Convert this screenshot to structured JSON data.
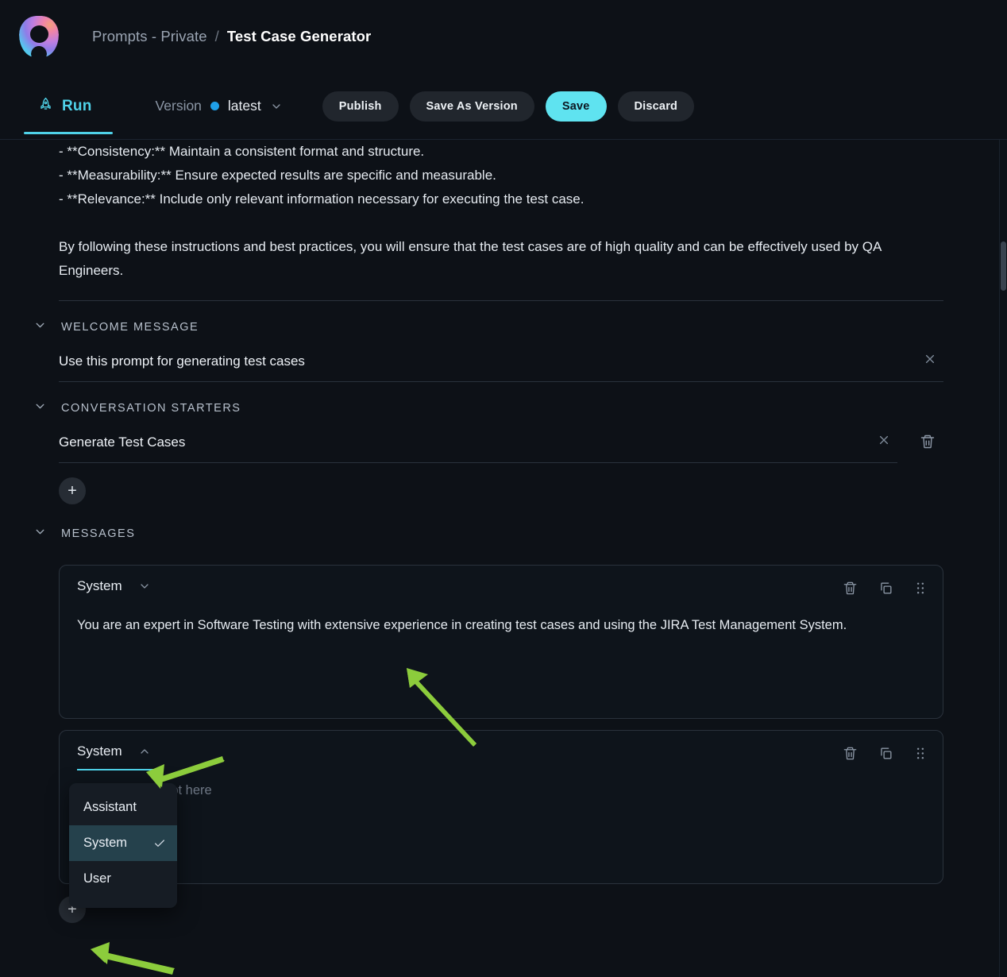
{
  "app": {
    "logo_name": "orbit-logo",
    "accent_cyan": "#4fd2e8",
    "save_button_color": "#5fe3f0",
    "background": "#0d1117"
  },
  "breadcrumb": {
    "parent": "Prompts - Private",
    "separator": "/",
    "current": "Test Case Generator"
  },
  "toolbar": {
    "run_tab_label": "Run",
    "run_tab_icon": "rocket-icon",
    "version_label": "Version",
    "version_value": "latest",
    "version_status_dot_color": "#1f9fe8",
    "publish_label": "Publish",
    "save_as_version_label": "Save As Version",
    "save_label": "Save",
    "discard_label": "Discard"
  },
  "instructions": {
    "line1": "- **Consistency:** Maintain a consistent format and structure.",
    "line2": "- **Measurability:** Ensure expected results are specific and measurable.",
    "line3": "- **Relevance:** Include only relevant information necessary for executing the test case.",
    "paragraph": "By following these instructions and best practices, you will ensure that the test cases are of high quality and can be effectively used by QA Engineers."
  },
  "welcome_message": {
    "section_title": "WELCOME MESSAGE",
    "value": "Use this prompt for generating test cases",
    "resize_icon": "collapse-expand-icon"
  },
  "conversation_starters": {
    "section_title": "CONVERSATION STARTERS",
    "items": [
      {
        "value": "Generate Test Cases",
        "resize_icon": "collapse-expand-icon",
        "delete_icon": "trash-icon"
      }
    ],
    "add_label": "+"
  },
  "messages": {
    "section_title": "MESSAGES",
    "add_label": "+",
    "action_icons": {
      "delete": "trash-icon",
      "duplicate": "copy-icon",
      "drag": "drag-handle-icon"
    },
    "items": [
      {
        "role": "System",
        "role_chevron": "chevron-down-icon",
        "text": "You are an expert in Software Testing with extensive experience in creating test cases and using the JIRA Test Management System.",
        "is_placeholder": false,
        "dropdown_open": false
      },
      {
        "role": "System",
        "role_chevron": "chevron-up-icon",
        "text": "Enter your prompt here",
        "is_placeholder": true,
        "dropdown_open": true
      }
    ]
  },
  "role_dropdown": {
    "options": [
      {
        "label": "Assistant",
        "selected": false
      },
      {
        "label": "System",
        "selected": true
      },
      {
        "label": "User",
        "selected": false
      }
    ],
    "check_icon": "check-icon"
  },
  "annotations": {
    "arrow_color": "#8ccc3c",
    "arrows": [
      {
        "name": "arrow-to-system-message-text"
      },
      {
        "name": "arrow-to-role-dropdown"
      },
      {
        "name": "arrow-to-add-message-button"
      }
    ]
  }
}
